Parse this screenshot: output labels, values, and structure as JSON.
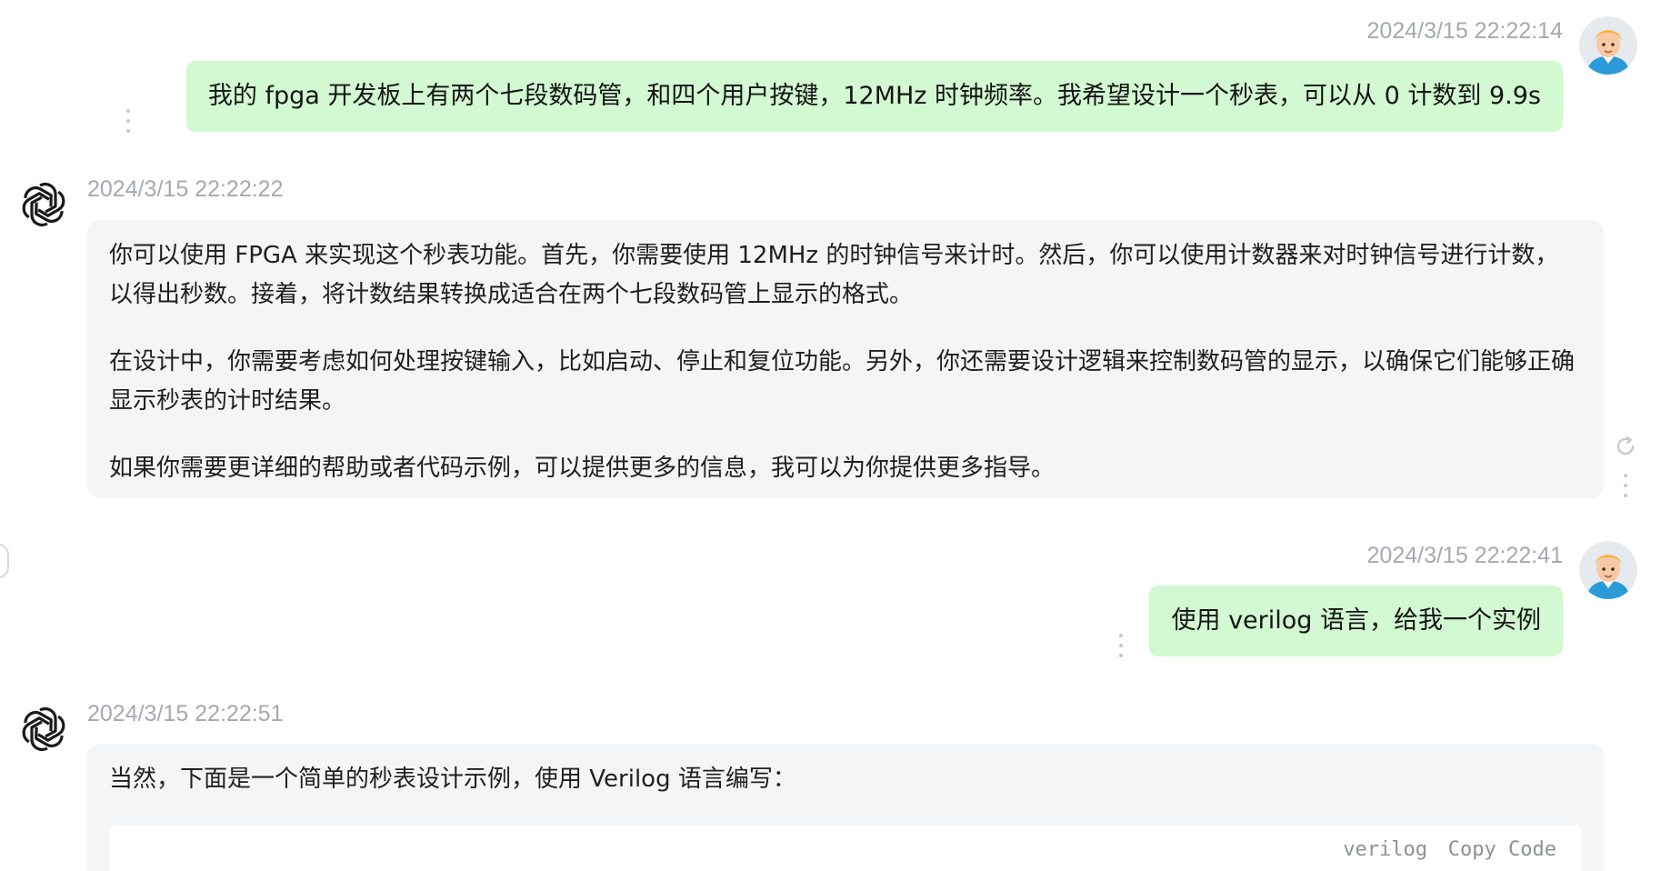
{
  "messages": [
    {
      "role": "user",
      "timestamp": "2024/3/15 22:22:14",
      "text": "我的 fpga 开发板上有两个七段数码管，和四个用户按键，12MHz 时钟频率。我希望设计一个秒表，可以从 0 计数到 9.9s"
    },
    {
      "role": "assistant",
      "timestamp": "2024/3/15 22:22:22",
      "paragraphs": [
        "你可以使用 FPGA 来实现这个秒表功能。首先，你需要使用 12MHz 的时钟信号来计时。然后，你可以使用计数器来对时钟信号进行计数，以得出秒数。接着，将计数结果转换成适合在两个七段数码管上显示的格式。",
        "在设计中，你需要考虑如何处理按键输入，比如启动、停止和复位功能。另外，你还需要设计逻辑来控制数码管的显示，以确保它们能够正确显示秒表的计时结果。",
        "如果你需要更详细的帮助或者代码示例，可以提供更多的信息，我可以为你提供更多指导。"
      ]
    },
    {
      "role": "user",
      "timestamp": "2024/3/15 22:22:41",
      "text": "使用 verilog 语言，给我一个实例"
    },
    {
      "role": "assistant",
      "timestamp": "2024/3/15 22:22:51",
      "paragraphs": [
        "当然，下面是一个简单的秒表设计示例，使用 Verilog 语言编写："
      ],
      "code_lang": "verilog",
      "code_copy_label": "Copy Code"
    }
  ],
  "icons": {
    "user_avatar": "user-avatar-icon",
    "bot_logo": "openai-logo-icon",
    "more": "more-vertical-icon",
    "refresh": "refresh-icon"
  },
  "colors": {
    "user_bubble": "#d2f9d1",
    "bot_bubble": "#f4f5f7",
    "timestamp": "#a5a9b2"
  }
}
